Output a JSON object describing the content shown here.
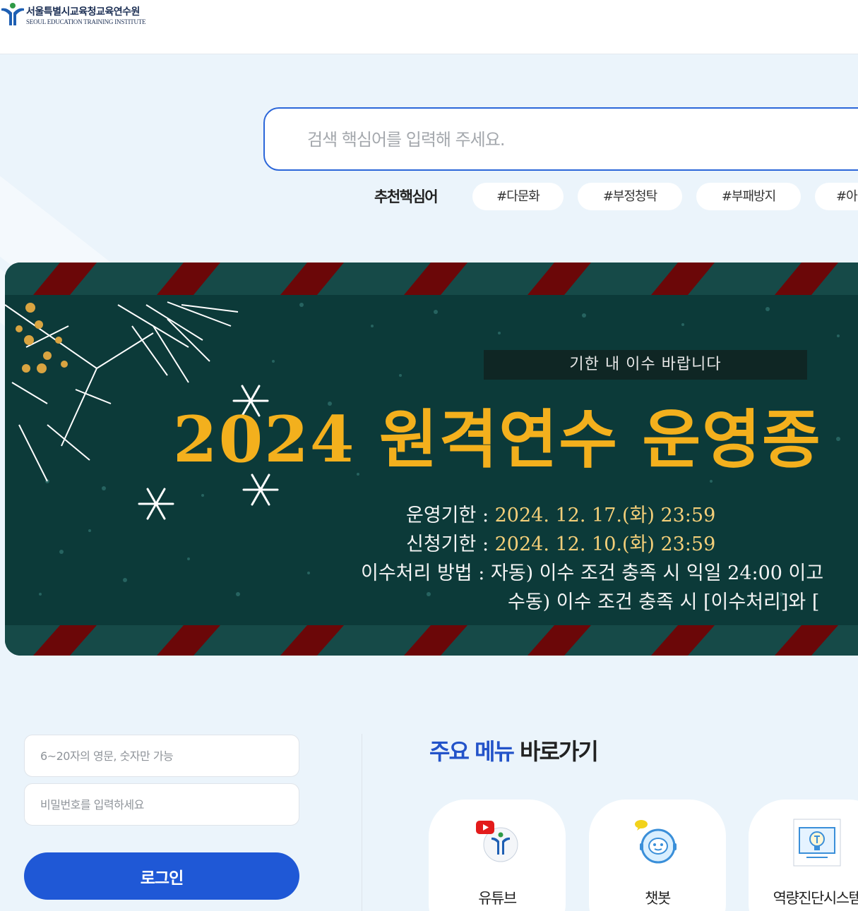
{
  "header": {
    "logo_kr": "서울특별시교육청교육연수원",
    "logo_en": "SEOUL EDUCATION TRAINING INSTITUTE"
  },
  "search": {
    "placeholder": "검색 핵심어를 입력해 주세요.",
    "value": ""
  },
  "recommend": {
    "label": "추천핵심어",
    "tags": [
      "#다문화",
      "#부정청탁",
      "#부패방지",
      "#아"
    ]
  },
  "banner": {
    "notice": "기한 내 이수 바랍니다",
    "title": "2024 원격연수 운영종",
    "rows": [
      {
        "label": "운영기한 : ",
        "text": "2024. 12. 17.(화) 23:59"
      },
      {
        "label": "신청기한 : ",
        "text": "2024. 12. 10.(화) 23:59"
      },
      {
        "label": "이수처리 방법 : ",
        "text": "자동) 이수 조건 충족 시 익일 24:00 이고"
      },
      {
        "label": "",
        "text": "수동) 이수 조건 충족 시 [이수처리]와 ["
      }
    ],
    "colors": {
      "background": "#0c3a39",
      "stripe": "#6b0708",
      "title": "#f3b01d"
    }
  },
  "login": {
    "id_placeholder": "6~20자의 영문, 숫자만 가능",
    "pw_placeholder": "비밀번호를 입력하세요",
    "button": "로그인"
  },
  "quick_menu": {
    "title_highlight": "주요 메뉴",
    "title_rest": " 바로가기",
    "items": [
      {
        "label": "유튜브",
        "icon": "youtube-icon"
      },
      {
        "label": "챗봇",
        "icon": "chatbot-icon"
      },
      {
        "label": "역량진단시스템",
        "icon": "competency-diagnosis-icon"
      }
    ]
  },
  "colors": {
    "accent": "#2353c9",
    "button": "#1f58d6",
    "page_bg": "#ebf4fb"
  }
}
